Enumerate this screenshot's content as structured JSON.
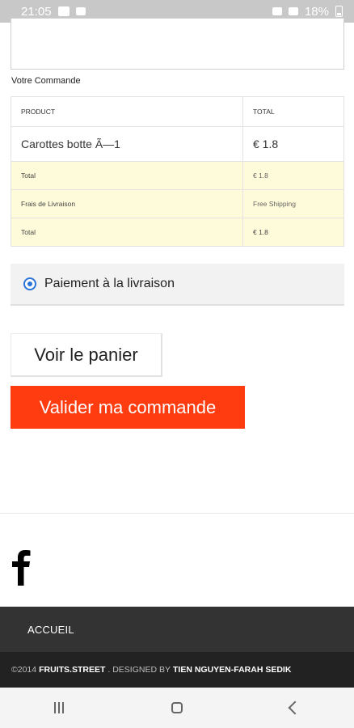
{
  "status_bar": {
    "time": "21:05",
    "battery": "18%"
  },
  "order": {
    "title": "Votre Commande",
    "header_product": "PRODUCT",
    "header_total": "TOTAL",
    "items": [
      {
        "name": "Carottes botte Ã—1",
        "total": "€ 1.8"
      }
    ],
    "summary": [
      {
        "label": "Total",
        "value": "€ 1.8"
      },
      {
        "label": "Frais de Livraison",
        "value": "Free Shipping"
      },
      {
        "label": "Total",
        "value": "€ 1.8"
      }
    ]
  },
  "payment": {
    "label": "Paiement à la livraison",
    "selected": true
  },
  "buttons": {
    "view_cart": "Voir le panier",
    "validate": "Valider ma commande"
  },
  "colors": {
    "accent": "#ff3b10",
    "footer_nav": "#333333",
    "footer_copy": "#222222",
    "summary_bg": "#fdfbd9"
  },
  "social": {
    "icon": "facebook-icon"
  },
  "footer": {
    "nav_item": "ACCUEIL",
    "copyright_prefix": "©2014",
    "brand": "FRUITS.STREET",
    "designed_by": ". DESIGNED BY",
    "designer": "TIEN NGUYEN-FARAH SEDIK"
  }
}
